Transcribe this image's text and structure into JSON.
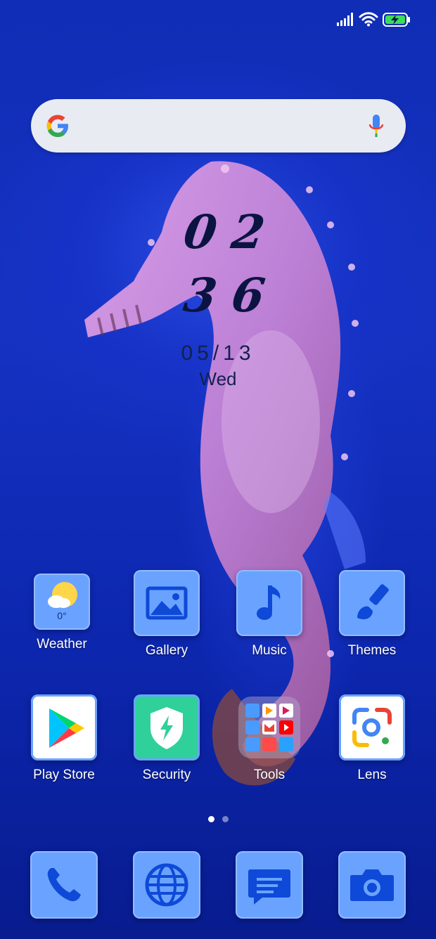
{
  "clock": {
    "hours": "02",
    "minutes": "36",
    "date": "05/13",
    "weekday": "Wed"
  },
  "weather": {
    "temperature": "0°"
  },
  "apps_row1": [
    {
      "label": "Weather",
      "icon": "weather-sun-cloud-icon"
    },
    {
      "label": "Gallery",
      "icon": "gallery-image-icon"
    },
    {
      "label": "Music",
      "icon": "music-note-icon"
    },
    {
      "label": "Themes",
      "icon": "paintbrush-icon"
    }
  ],
  "apps_row2": [
    {
      "label": "Play Store",
      "icon": "play-store-icon"
    },
    {
      "label": "Security",
      "icon": "security-shield-icon"
    },
    {
      "label": "Tools",
      "icon": "tools-folder-icon"
    },
    {
      "label": "Lens",
      "icon": "google-lens-icon"
    }
  ],
  "dock": [
    {
      "icon": "phone-icon"
    },
    {
      "icon": "browser-globe-icon"
    },
    {
      "icon": "messages-icon"
    },
    {
      "icon": "camera-icon"
    }
  ],
  "pages": {
    "count": 2,
    "active": 0
  },
  "colors": {
    "icon_tile": "#6aa3ff",
    "icon_glyph": "#0f49d8",
    "battery": "#3ddc5a",
    "security": "#2fd09a"
  }
}
